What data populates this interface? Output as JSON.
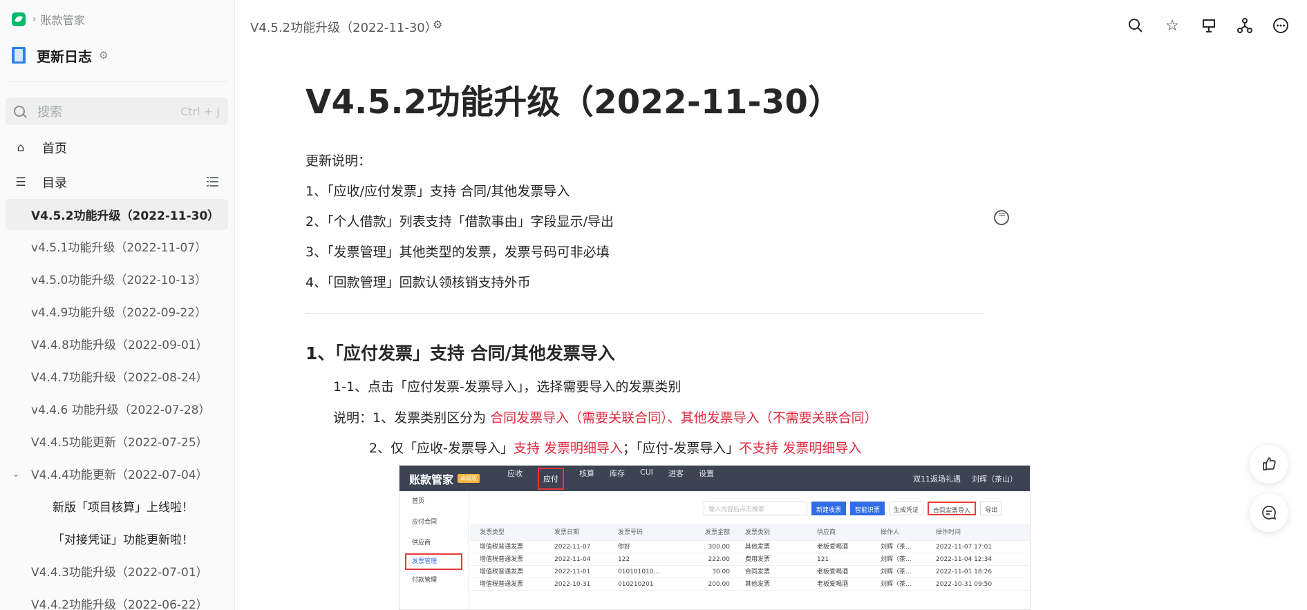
{
  "sidebar": {
    "breadcrumb": "账款管家",
    "book_title": "更新日志",
    "search_placeholder": "搜索",
    "search_shortcut": "Ctrl + J",
    "home_label": "首页",
    "toc_label": "目录",
    "toc_items": [
      {
        "label": "V4.5.2功能升级（2022-11-30）"
      },
      {
        "label": "v4.5.1功能升级（2022-11-07）"
      },
      {
        "label": "v4.5.0功能升级（2022-10-13）"
      },
      {
        "label": "v4.4.9功能升级（2022-09-22）"
      },
      {
        "label": "V4.4.8功能升级（2022-09-01）"
      },
      {
        "label": "V4.4.7功能升级（2022-08-24）"
      },
      {
        "label": "v4.4.6 功能升级（2022-07-28）"
      },
      {
        "label": "V4.4.5功能更新（2022-07-25）"
      },
      {
        "label": "V4.4.4功能更新（2022-07-04）"
      },
      {
        "label": "新版「项目核算」上线啦！"
      },
      {
        "label": "「对接凭证」功能更新啦！"
      },
      {
        "label": "V4.4.3功能升级（2022-07-01）"
      },
      {
        "label": "V4.4.2功能升级（2022-06-22）"
      }
    ]
  },
  "topbar": {
    "title": "V4.5.2功能升级（2022-11-30）",
    "icons": [
      "search-icon",
      "star-icon",
      "present-icon",
      "share-icon",
      "more-icon"
    ]
  },
  "doc": {
    "title": "V4.5.2功能升级（2022-11-30）",
    "intro": "更新说明：",
    "points": [
      "1、「应收/应付发票」支持 合同/其他发票导入",
      "2、「个人借款」列表支持「借款事由」字段显示/导出",
      "3、「发票管理」其他类型的发票，发票号码可非必填",
      "4、「回款管理」回款认领核销支持外币"
    ],
    "section_heading": "1、「应付发票」支持 合同/其他发票导入",
    "step": "1-1、点击「应付发票-发票导入」，选择需要导入的发票类别",
    "note1_prefix": "说明：1、发票类别区分为 ",
    "note1_red": "合同发票导入（需要关联合同）、其他发票导入（不需要关联合同）",
    "note2_a": "2、仅「应收-发票导入」",
    "note2_b": "支持 发票明细导入",
    "note2_c": "；「应付-发票导入」",
    "note2_d": "不支持 发票明细导入"
  },
  "screenshot": {
    "brand": "账款管家",
    "tag": "高级版",
    "nav": [
      "应收",
      "应付",
      "核算",
      "库存",
      "CUI",
      "进客",
      "设置"
    ],
    "right": [
      "双11返场礼遇",
      "刘辉（茶山）"
    ],
    "side": [
      "首页",
      "应付合同",
      "供应商",
      "发票管理",
      "付款管理"
    ],
    "search_placeholder": "输入内容后点击搜索",
    "buttons": [
      "新建收票",
      "智能识票",
      "生成凭证",
      "合同发票导入",
      "导出"
    ],
    "columns": [
      "发票类型",
      "发票日期",
      "发票号码",
      "发票金额",
      "发票类别",
      "供应商",
      "操作人",
      "操作时间"
    ],
    "rows": [
      [
        "增值税普通发票",
        "2022-11-07",
        "你好",
        "300.00",
        "其他发票",
        "老板爱喝酒",
        "刘辉（茶...",
        "2022-11-07 17:01"
      ],
      [
        "增值税普通发票",
        "2022-11-04",
        "122",
        "222.00",
        "费用发票",
        "121",
        "刘辉（茶...",
        "2022-11-04 12:34"
      ],
      [
        "增值税普通发票",
        "2022-11-01",
        "010101010...",
        "30.00",
        "合同发票",
        "老板爱喝酒",
        "刘辉（茶...",
        "2022-11-01 18:26"
      ],
      [
        "增值税普通发票",
        "2022-10-31",
        "010210201",
        "200.00",
        "其他发票",
        "老板爱喝酒",
        "刘辉（茶...",
        "2022-10-31 09:50"
      ]
    ]
  }
}
